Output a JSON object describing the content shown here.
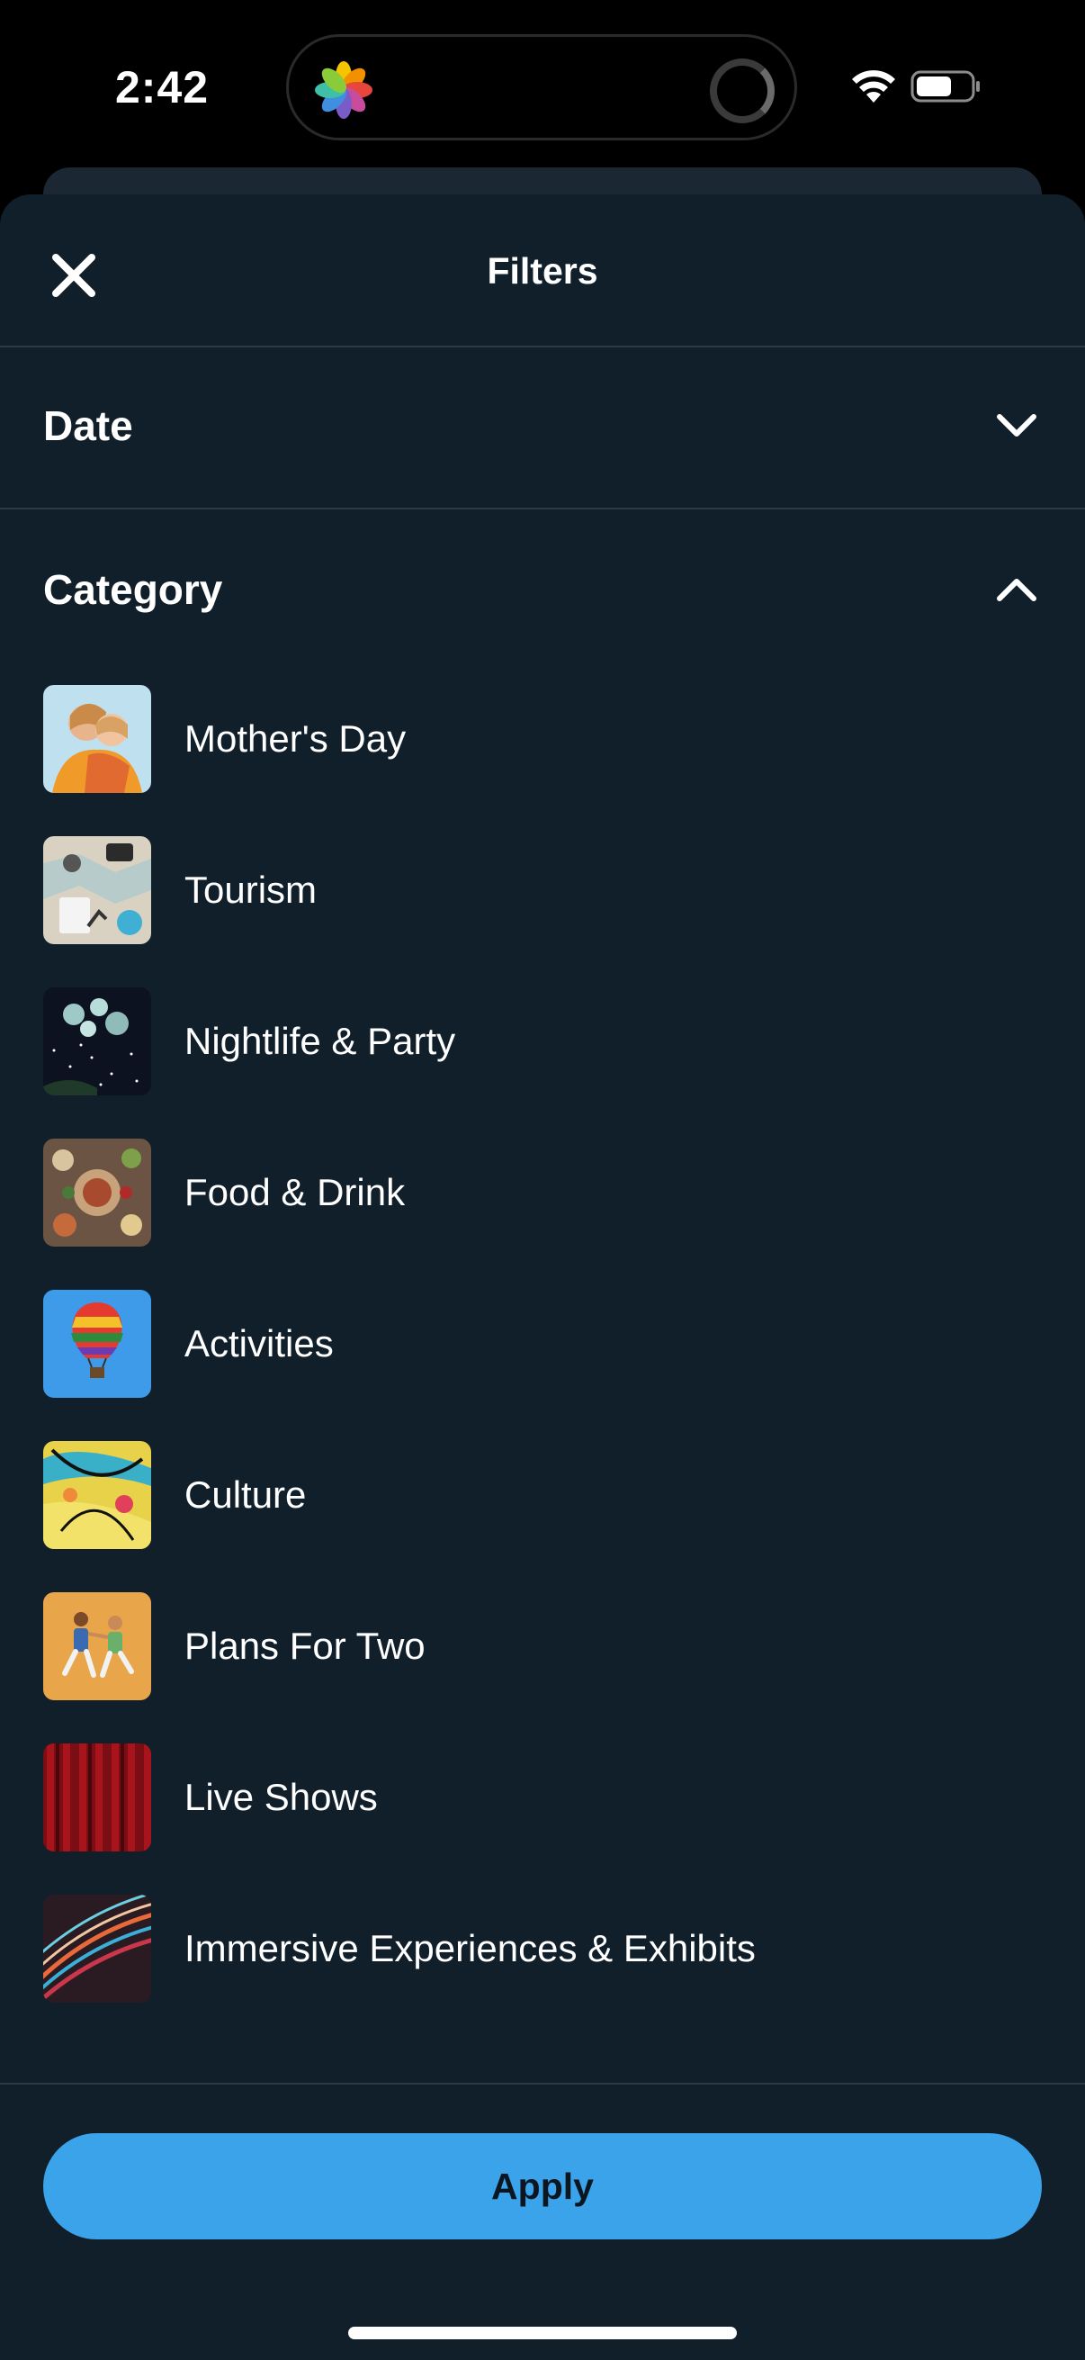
{
  "status_bar": {
    "time": "2:42",
    "icons": [
      "photos-icon",
      "spinner-icon",
      "wifi-icon",
      "battery-icon"
    ]
  },
  "sheet": {
    "close_icon": "close-icon",
    "title": "Filters"
  },
  "sections": {
    "date": {
      "label": "Date",
      "expanded": false,
      "icon": "chevron-down-icon"
    },
    "category": {
      "label": "Category",
      "expanded": true,
      "icon": "chevron-up-icon"
    }
  },
  "categories": [
    {
      "label": "Mother's Day",
      "thumbnail": "mother-hug-photo"
    },
    {
      "label": "Tourism",
      "thumbnail": "map-travel-photo"
    },
    {
      "label": "Nightlife & Party",
      "thumbnail": "disco-balls-photo"
    },
    {
      "label": "Food & Drink",
      "thumbnail": "food-table-photo"
    },
    {
      "label": "Activities",
      "thumbnail": "hot-air-balloon-photo"
    },
    {
      "label": "Culture",
      "thumbnail": "abstract-paint-photo"
    },
    {
      "label": "Plans For Two",
      "thumbnail": "jumping-couple-photo"
    },
    {
      "label": "Live Shows",
      "thumbnail": "red-curtain-photo"
    },
    {
      "label": "Immersive Experiences & Exhibits",
      "thumbnail": "light-trails-photo"
    }
  ],
  "footer": {
    "apply_label": "Apply"
  },
  "colors": {
    "background": "#000000",
    "sheet": "#111f2b",
    "divider": "#2b3a48",
    "accent": "#3ba3ea",
    "text": "#ffffff"
  }
}
